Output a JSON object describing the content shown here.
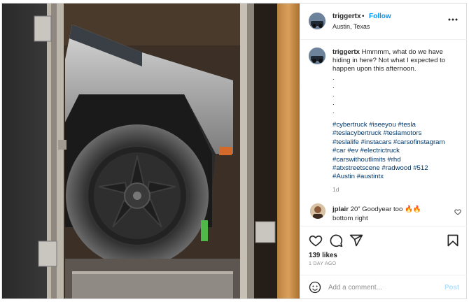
{
  "post": {
    "image_alt": "Cybertruck wheel inside a trailer",
    "author": {
      "username": "triggertx",
      "separator": "•",
      "follow_label": "Follow",
      "location": "Austin, Texas"
    },
    "caption": {
      "username": "triggertx",
      "text_line1": "Hmmmm, what do we have",
      "text_line2": "hiding in here? Not what I expected to",
      "text_line3": "happen upon this afternoon.",
      "dots": [
        ".",
        ".",
        ".",
        ".",
        "."
      ],
      "hashtag_lines": [
        "#cybertruck #iseeyou #tesla",
        "#teslacybertruck #teslamotors",
        "#teslalife #instacars #carsofinstagram",
        "#car #ev #electrictruck",
        "#carswithoutlimits #rhd",
        "#atxstreetscene #radwood #512",
        "#Austin #austintx"
      ],
      "age": "1d"
    },
    "comment": {
      "username": "jplair",
      "text": "20” Goodyear too 🔥🔥",
      "text_line2": "bottom right"
    },
    "stats": {
      "likes": "139 likes",
      "date": "1 DAY AGO"
    },
    "add_comment": {
      "placeholder": "Add a comment...",
      "post_label": "Post"
    }
  },
  "icons": {
    "more": "more-options-icon",
    "like": "heart-icon",
    "comment": "comment-icon",
    "share": "share-icon",
    "save": "bookmark-icon",
    "emoji": "emoji-icon",
    "comment_like": "heart-small-icon"
  },
  "colors": {
    "link": "#0095f6",
    "hashtag": "#00376b",
    "muted": "#8e8e8e",
    "border": "#dbdbdb",
    "post_disabled": "#b2dffc"
  }
}
